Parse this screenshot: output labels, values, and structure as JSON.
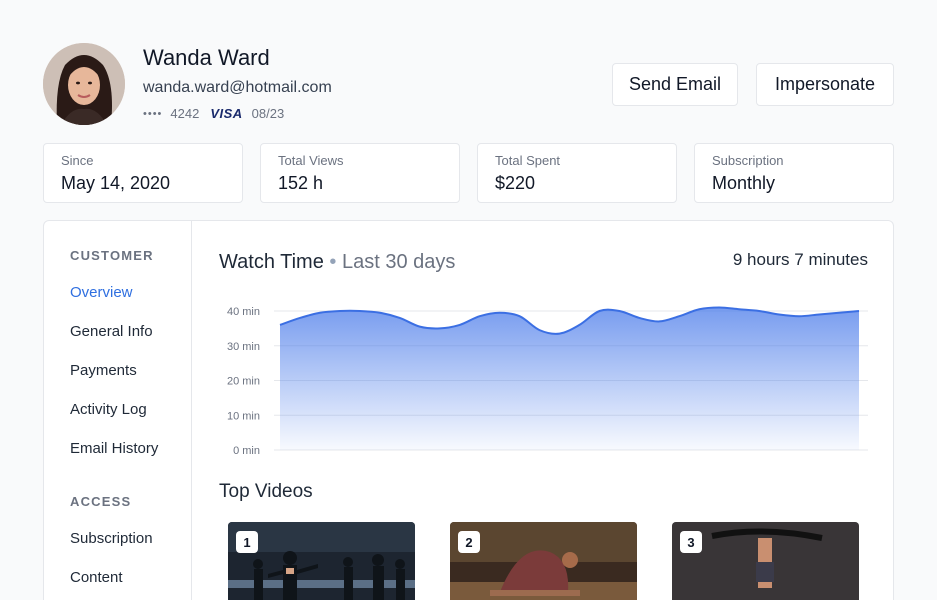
{
  "customer": {
    "name": "Wanda Ward",
    "email": "wanda.ward@hotmail.com",
    "card_mask": "••••",
    "card_last4": "4242",
    "card_brand": "VISA",
    "card_expiry": "08/23"
  },
  "actions": {
    "send_email": "Send Email",
    "impersonate": "Impersonate"
  },
  "stats": [
    {
      "label": "Since",
      "value": "May 14, 2020"
    },
    {
      "label": "Total Views",
      "value": "152 h"
    },
    {
      "label": "Total Spent",
      "value": "$220"
    },
    {
      "label": "Subscription",
      "value": "Monthly"
    }
  ],
  "sidebar": {
    "customer_heading": "CUSTOMER",
    "customer_items": [
      "Overview",
      "General Info",
      "Payments",
      "Activity Log",
      "Email History"
    ],
    "access_heading": "ACCESS",
    "access_items": [
      "Subscription",
      "Content"
    ]
  },
  "watch_time": {
    "title": "Watch Time",
    "separator": "•",
    "period": "Last 30 days",
    "total": "9 hours 7 minutes"
  },
  "chart_data": {
    "type": "area",
    "x": [
      1,
      2,
      3,
      4,
      5,
      6,
      7,
      8,
      9,
      10,
      11,
      12,
      13,
      14,
      15,
      16,
      17,
      18,
      19,
      20,
      21,
      22,
      23,
      24,
      25,
      26,
      27,
      28,
      29,
      30
    ],
    "series": [
      {
        "values": [
          36,
          38,
          39.5,
          40,
          40,
          39.5,
          38,
          35.5,
          35,
          36,
          38.5,
          39.5,
          38.5,
          34.5,
          33.5,
          36,
          40,
          40,
          38,
          37,
          38.5,
          40.5,
          41,
          40.5,
          40,
          39,
          38.5,
          39,
          39.5,
          40
        ]
      }
    ],
    "y_ticks": [
      "0 min",
      "10 min",
      "20 min",
      "30 min",
      "40 min"
    ],
    "ylim": [
      0,
      40
    ],
    "grid": true,
    "color": "#4a7bea"
  },
  "top_videos": {
    "title": "Top Videos",
    "items": [
      {
        "rank": "1"
      },
      {
        "rank": "2"
      },
      {
        "rank": "3"
      }
    ]
  }
}
